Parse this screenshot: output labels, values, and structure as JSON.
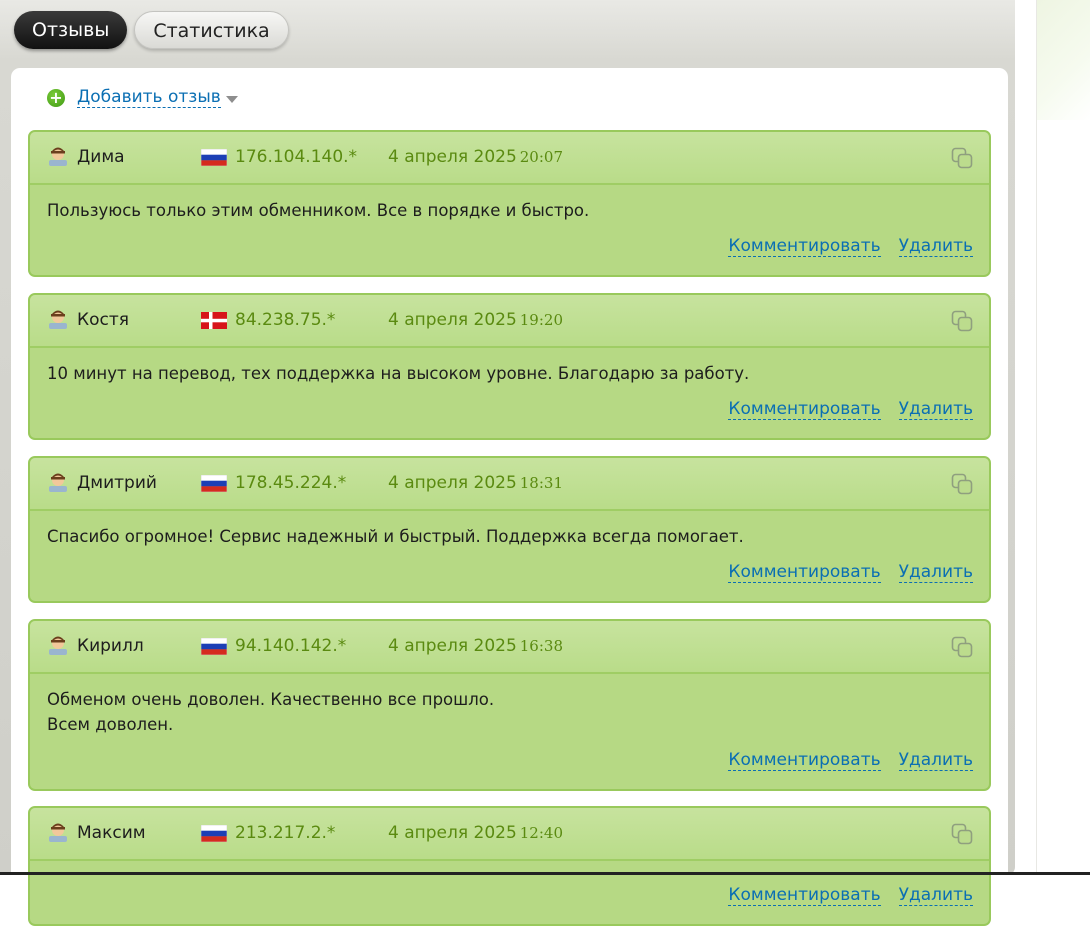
{
  "tabs": [
    {
      "label": "Отзывы",
      "active": true
    },
    {
      "label": "Статистика",
      "active": false
    }
  ],
  "add_review": {
    "label": "Добавить отзыв",
    "icon": "plus-circle-icon",
    "dropdown_icon": "caret-down-icon"
  },
  "colors": {
    "card_bg": "#b6d984",
    "card_border": "#99c95c",
    "link": "#0b6fb3",
    "meta_text": "#5a8a10",
    "active_tab": "#111111"
  },
  "reviews": [
    {
      "name": "Дима",
      "country": "Russia",
      "ip": "176.104.140.*",
      "date": "4 апреля 2025",
      "time": "20:07",
      "text": [
        "Пользуюсь только этим обменником. Все в порядке и быстро."
      ],
      "comment_label": "Комментировать",
      "delete_label": "Удалить"
    },
    {
      "name": "Костя",
      "country": "Denmark",
      "ip": "84.238.75.*",
      "date": "4 апреля 2025",
      "time": "19:20",
      "text": [
        "10 минут на перевод, тех поддержка на высоком уровне. Благодарю за работу."
      ],
      "comment_label": "Комментировать",
      "delete_label": "Удалить"
    },
    {
      "name": "Дмитрий",
      "country": "Russia",
      "ip": "178.45.224.*",
      "date": "4 апреля 2025",
      "time": "18:31",
      "text": [
        "Спасибо огромное! Сервис надежный и быстрый. Поддержка всегда помогает."
      ],
      "comment_label": "Комментировать",
      "delete_label": "Удалить"
    },
    {
      "name": "Кирилл",
      "country": "Russia",
      "ip": "94.140.142.*",
      "date": "4 апреля 2025",
      "time": "16:38",
      "text": [
        "Обменом очень доволен. Качественно все прошло.",
        "Всем доволен."
      ],
      "comment_label": "Комментировать",
      "delete_label": "Удалить"
    },
    {
      "name": "Максим",
      "country": "Russia",
      "ip": "213.217.2.*",
      "date": "4 апреля 2025",
      "time": "12:40",
      "text": [],
      "comment_label": "Комментировать",
      "delete_label": "Удалить"
    }
  ]
}
